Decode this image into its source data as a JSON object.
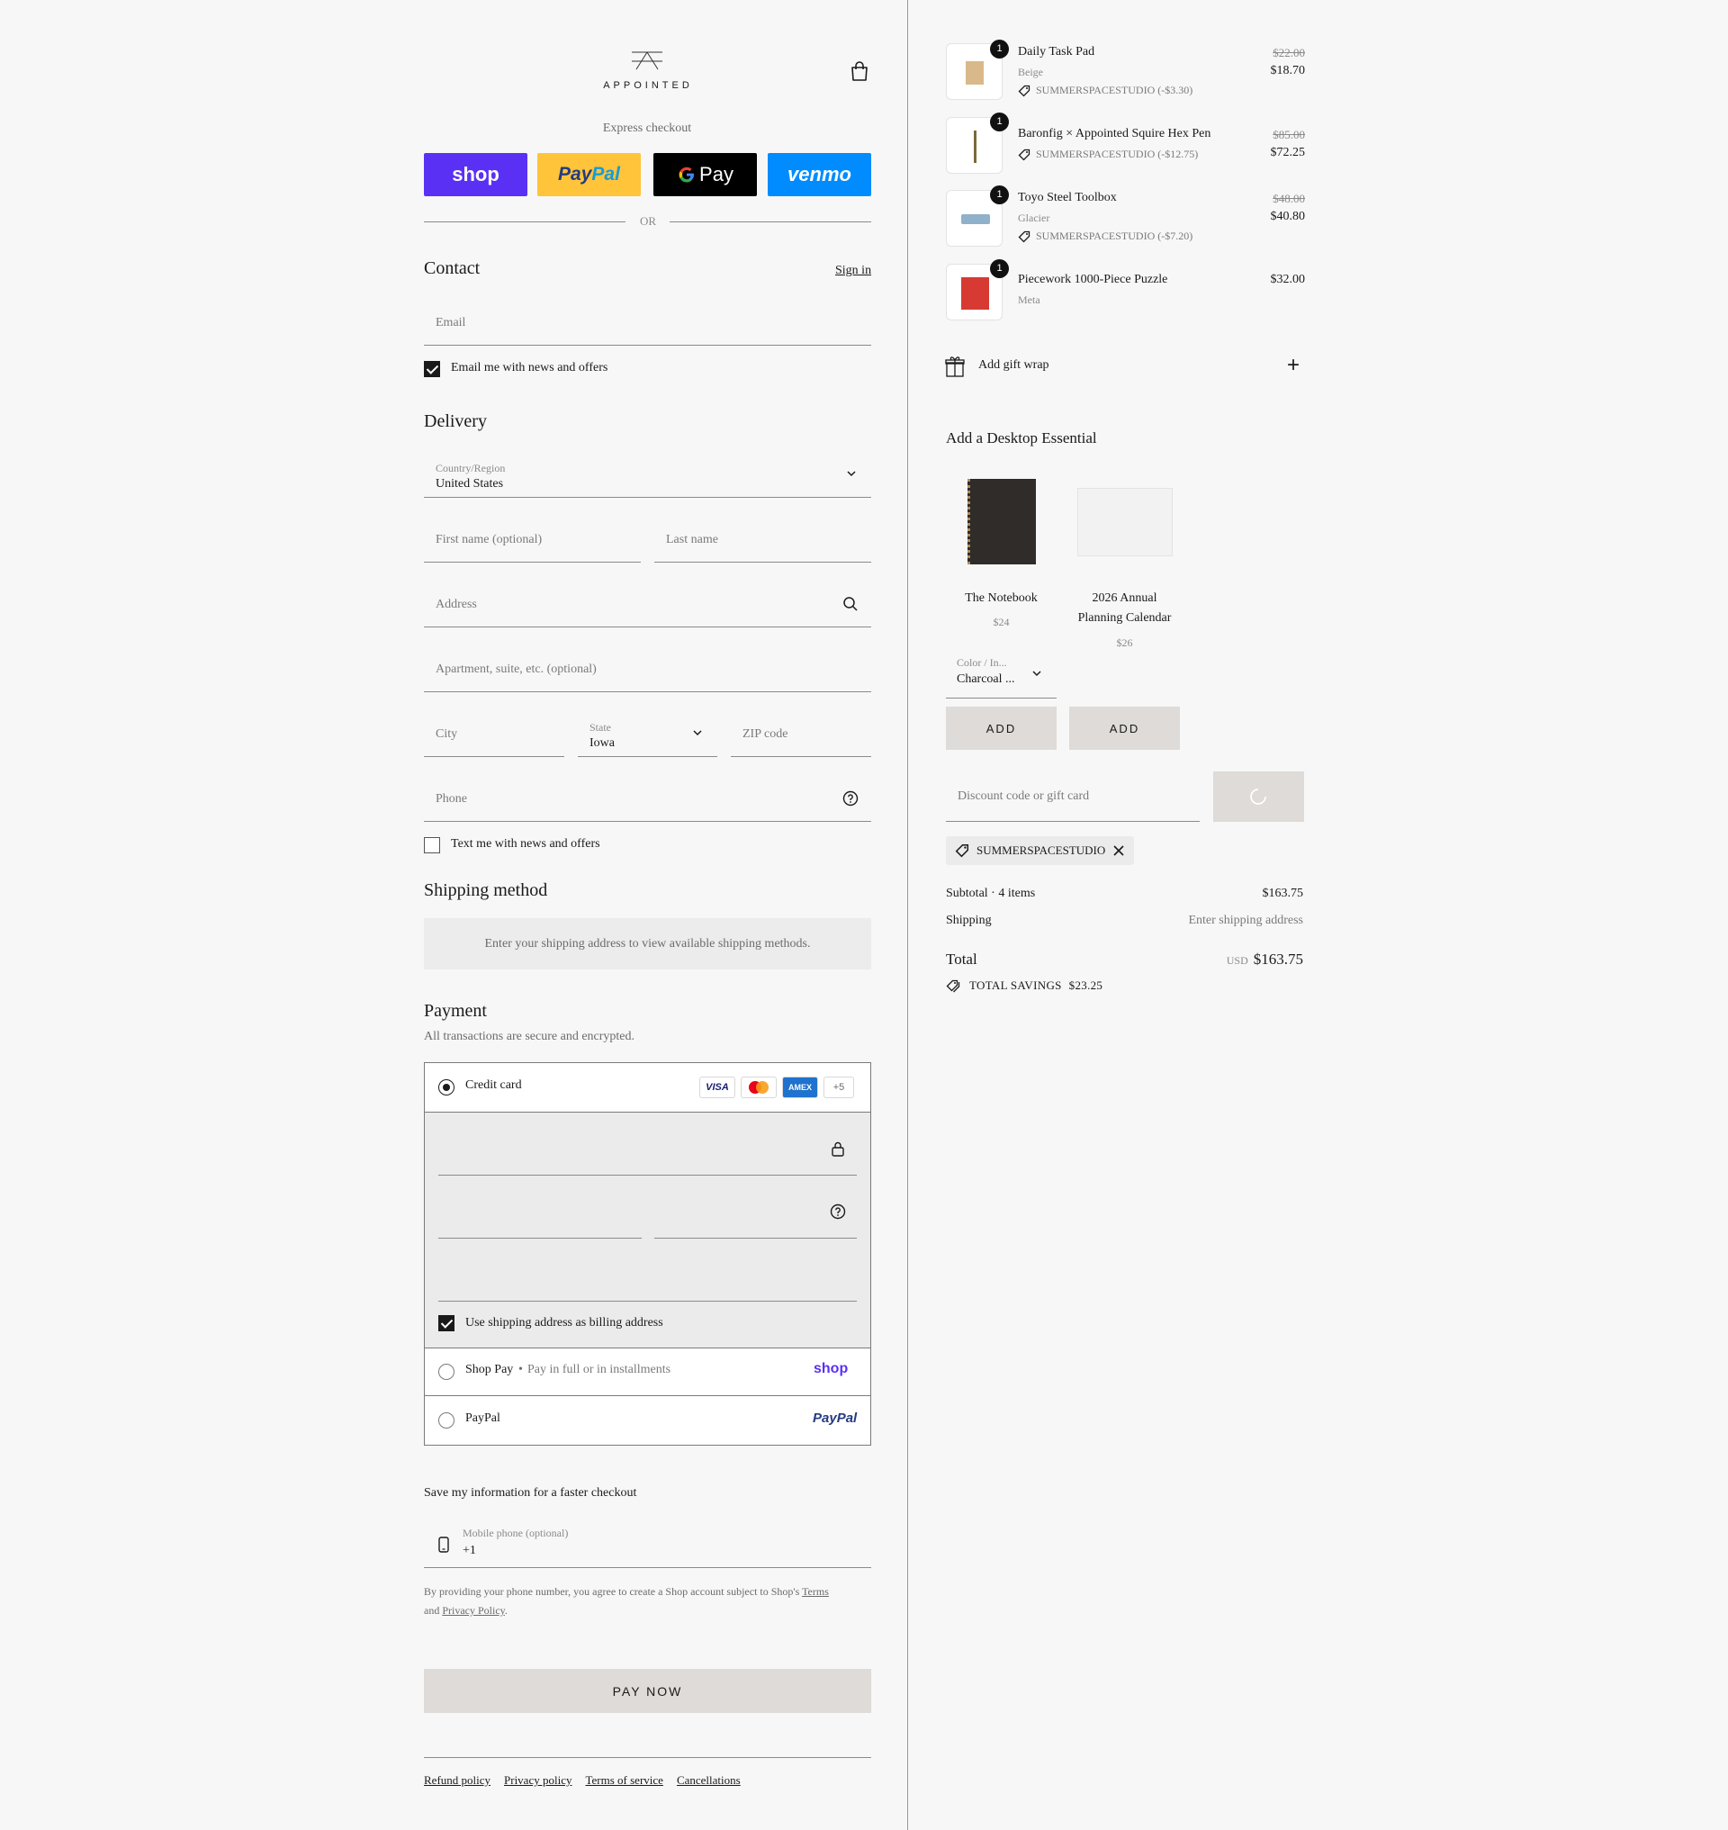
{
  "brand": {
    "name": "APPOINTED"
  },
  "express": {
    "label": "Express checkout",
    "buttons": {
      "shop": "shop",
      "paypal_a": "Pay",
      "paypal_b": "Pal",
      "gpay": "Pay",
      "venmo": "venmo"
    },
    "or": "OR"
  },
  "contact": {
    "title": "Contact",
    "sign_in": "Sign in",
    "email_placeholder": "Email",
    "email_opt_in": "Email me with news and offers"
  },
  "delivery": {
    "title": "Delivery",
    "country_label": "Country/Region",
    "country_value": "United States",
    "first_name_placeholder": "First name (optional)",
    "last_name_placeholder": "Last name",
    "address_placeholder": "Address",
    "apartment_placeholder": "Apartment, suite, etc. (optional)",
    "city_placeholder": "City",
    "state_label": "State",
    "state_value": "Iowa",
    "zip_placeholder": "ZIP code",
    "phone_placeholder": "Phone",
    "text_opt_in": "Text me with news and offers"
  },
  "shipping": {
    "title": "Shipping method",
    "info": "Enter your shipping address to view available shipping methods."
  },
  "payment": {
    "title": "Payment",
    "subtitle": "All transactions are secure and encrypted.",
    "credit_card": "Credit card",
    "card_logos": {
      "visa": "VISA",
      "amex": "AMEX",
      "more": "+5"
    },
    "billing_same": "Use shipping address as billing address",
    "shop_pay": "Shop Pay",
    "shop_pay_sub": "Pay in full or in installments",
    "shop_logo": "shop",
    "paypal": "PayPal",
    "paypal_logo": "PayPal"
  },
  "save_info": {
    "title": "Save my information for a faster checkout",
    "mobile_label": "Mobile phone (optional)",
    "mobile_value": "+1",
    "legal_prefix": "By providing your phone number, you agree to create a Shop account subject to Shop's",
    "terms": "Terms",
    "and": "and",
    "privacy": "Privacy Policy"
  },
  "pay_now": "PAY NOW",
  "footer": [
    "Refund policy",
    "Privacy policy",
    "Terms of service",
    "Cancellations"
  ],
  "cart": {
    "items": [
      {
        "qty": "1",
        "name": "Daily Task Pad",
        "variant": "Beige",
        "discount": "SUMMERSPACESTUDIO (-$3.30)",
        "old_price": "$22.00",
        "price": "$18.70"
      },
      {
        "qty": "1",
        "name": "Baronfig × Appointed Squire Hex Pen",
        "variant": "",
        "discount": "SUMMERSPACESTUDIO (-$12.75)",
        "old_price": "$85.00",
        "price": "$72.25"
      },
      {
        "qty": "1",
        "name": "Toyo Steel Toolbox",
        "variant": "Glacier",
        "discount": "SUMMERSPACESTUDIO (-$7.20)",
        "old_price": "$48.00",
        "price": "$40.80"
      },
      {
        "qty": "1",
        "name": "Piecework 1000-Piece Puzzle",
        "variant": "Meta",
        "discount": "",
        "old_price": "",
        "price": "$32.00"
      }
    ],
    "gift_wrap": "Add gift wrap",
    "upsell_title": "Add a Desktop Essential",
    "upsell": [
      {
        "name": "The Notebook",
        "price": "$24",
        "select_label": "Color / In...",
        "select_value": "Charcoal ...",
        "button": "ADD"
      },
      {
        "name_line1": "2026 Annual",
        "name_line2": "Planning Calendar",
        "price": "$26",
        "button": "ADD"
      }
    ],
    "discount_placeholder": "Discount code or gift card",
    "applied_code": "SUMMERSPACESTUDIO",
    "subtotal_label": "Subtotal · 4 items",
    "subtotal_value": "$163.75",
    "shipping_label": "Shipping",
    "shipping_value": "Enter shipping address",
    "total_label": "Total",
    "total_currency": "USD",
    "total_value": "$163.75",
    "savings_label": "TOTAL SAVINGS",
    "savings_value": "$23.25"
  }
}
